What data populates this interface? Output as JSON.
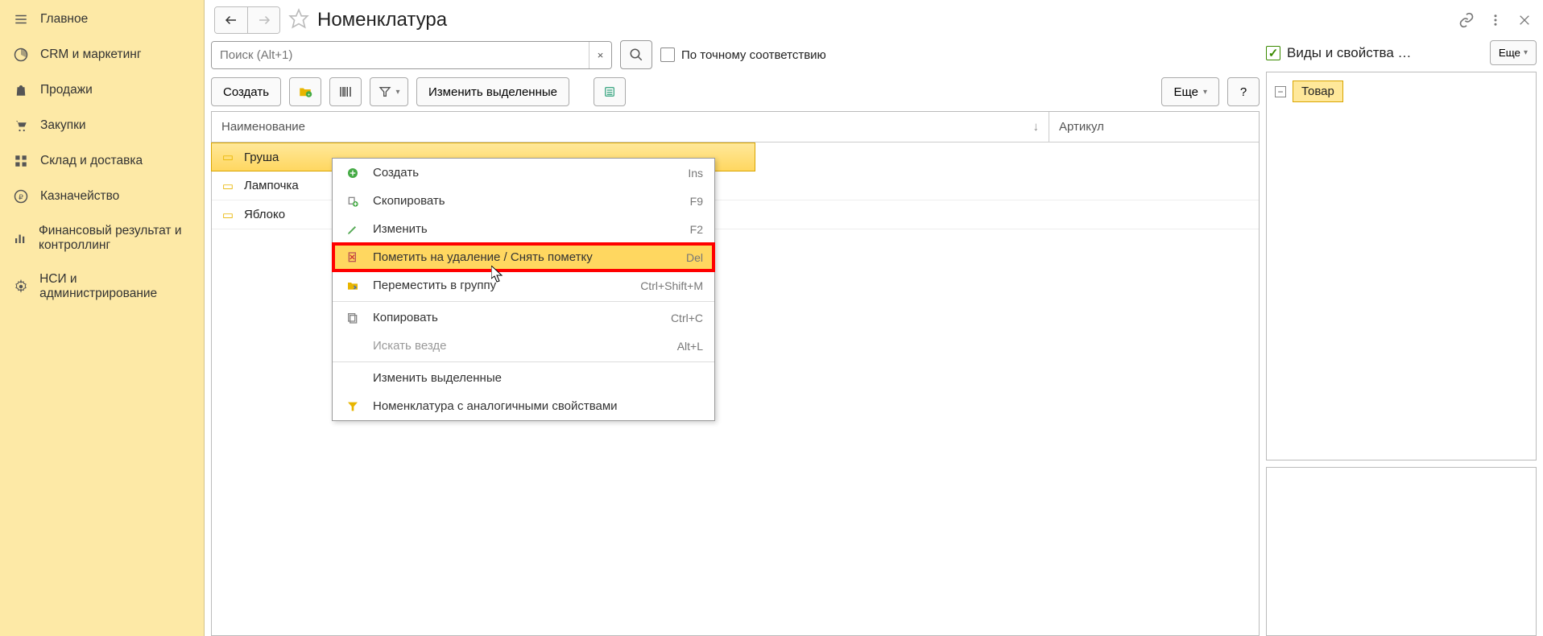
{
  "sidebar": {
    "items": [
      {
        "label": "Главное"
      },
      {
        "label": "CRM и маркетинг"
      },
      {
        "label": "Продажи"
      },
      {
        "label": "Закупки"
      },
      {
        "label": "Склад и доставка"
      },
      {
        "label": "Казначейство"
      },
      {
        "label": "Финансовый результат и контроллинг"
      },
      {
        "label": "НСИ и администрирование"
      }
    ]
  },
  "header": {
    "title": "Номенклатура"
  },
  "search": {
    "placeholder": "Поиск (Alt+1)",
    "exact_label": "По точному соответствию"
  },
  "toolbar": {
    "create": "Создать",
    "edit_selected": "Изменить выделенные",
    "more": "Еще",
    "help": "?"
  },
  "table": {
    "col_name": "Наименование",
    "col_art": "Артикул",
    "rows": [
      {
        "label": "Груша"
      },
      {
        "label": "Лампочка"
      },
      {
        "label": "Яблоко"
      }
    ]
  },
  "context_menu": {
    "items": [
      {
        "label": "Создать",
        "shortcut": "Ins",
        "icon": "plus"
      },
      {
        "label": "Скопировать",
        "shortcut": "F9",
        "icon": "copy-plus"
      },
      {
        "label": "Изменить",
        "shortcut": "F2",
        "icon": "pencil"
      },
      {
        "label": "Пометить на удаление / Снять пометку",
        "shortcut": "Del",
        "icon": "delete-mark",
        "highlight": true
      },
      {
        "label": "Переместить в группу",
        "shortcut": "Ctrl+Shift+M",
        "icon": "move"
      },
      {
        "label": "Копировать",
        "shortcut": "Ctrl+C",
        "icon": "copy"
      },
      {
        "label": "Искать везде",
        "shortcut": "Alt+L",
        "icon": "",
        "disabled": true
      },
      {
        "label": "Изменить выделенные",
        "shortcut": "",
        "icon": ""
      },
      {
        "label": "Номенклатура с аналогичными свойствами",
        "shortcut": "",
        "icon": "filter-props"
      }
    ]
  },
  "right": {
    "title": "Виды и свойства …",
    "more": "Еще",
    "tree_item": "Товар"
  }
}
